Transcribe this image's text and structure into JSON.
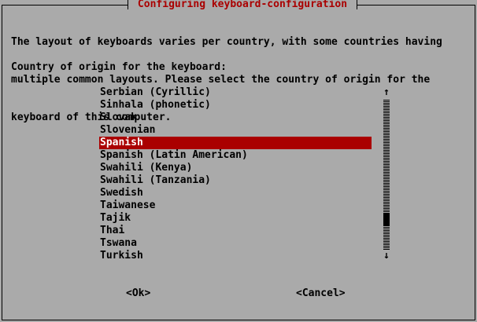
{
  "dialog": {
    "title": " Configuring keyboard-configuration ",
    "description_lines": [
      "The layout of keyboards varies per country, with some countries having",
      "multiple common layouts. Please select the country of origin for the",
      "keyboard of this computer."
    ],
    "prompt": "Country of origin for the keyboard:"
  },
  "list": {
    "items": [
      "Serbian (Cyrillic)",
      "Sinhala (phonetic)",
      "Slovak",
      "Slovenian",
      "Spanish",
      "Spanish (Latin American)",
      "Swahili (Kenya)",
      "Swahili (Tanzania)",
      "Swedish",
      "Taiwanese",
      "Tajik",
      "Thai",
      "Tswana",
      "Turkish"
    ],
    "selected_index": 4
  },
  "scrollbar": {
    "up_arrow": "↑",
    "down_arrow": "↓",
    "position_fraction": 0.83
  },
  "buttons": {
    "ok": "<Ok>",
    "cancel": "<Cancel>"
  },
  "colors": {
    "background": "#aaaaaa",
    "highlight": "#aa0000",
    "highlight_text": "#ffffff",
    "title_text": "#aa0000",
    "text": "#000000"
  }
}
